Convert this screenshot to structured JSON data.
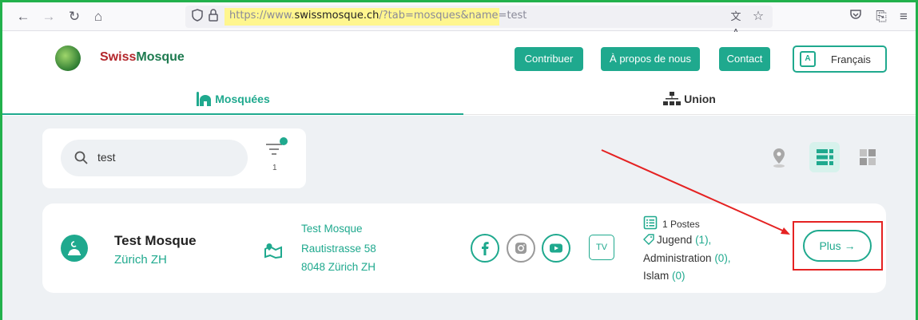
{
  "browser": {
    "url_prefix": "https://www.",
    "url_domain": "swissmosque.ch",
    "url_rest": "/?tab=mosques&name=test"
  },
  "header": {
    "brand_part1": "Swiss",
    "brand_part2": "Mosque",
    "buttons": {
      "contribute": "Contribuer",
      "about": "À propos de nous",
      "contact": "Contact"
    },
    "language": {
      "icon_text": "A",
      "label": "Français"
    }
  },
  "tabs": {
    "mosques": "Mosquées",
    "union": "Union"
  },
  "search": {
    "value": "test",
    "filter_count": "1"
  },
  "result": {
    "name": "Test Mosque",
    "city": "Zürich ZH",
    "address": {
      "line1": "Test Mosque",
      "line2": "Rautistrasse 58",
      "line3": "8048 Zürich ZH"
    },
    "tv_label": "TV",
    "posts": {
      "total": "1 Postes",
      "jugend_label": "Jugend",
      "jugend_count": "(1),",
      "admin_label": "Administration",
      "admin_count": "(0),",
      "islam_label": "Islam",
      "islam_count": "(0)"
    },
    "more_label": "Plus"
  },
  "colors": {
    "accent": "#1fa98e",
    "annotation": "#e52222",
    "frame": "#22b14c"
  }
}
